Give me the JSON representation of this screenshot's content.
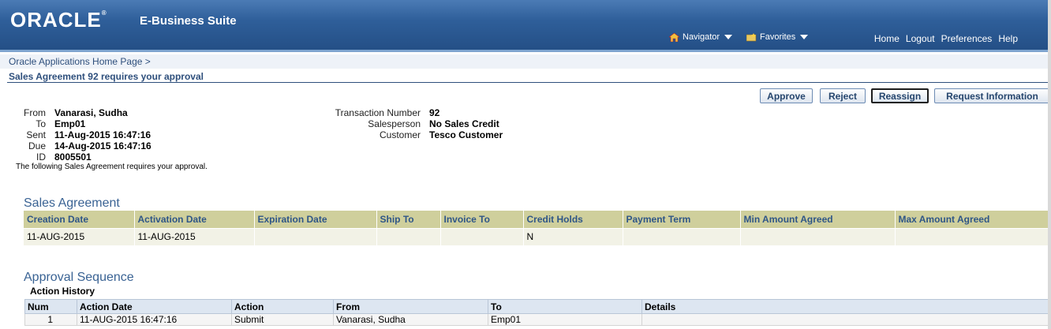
{
  "header": {
    "brand": "ORACLE",
    "suite": "E-Business Suite",
    "navigator": "Navigator",
    "favorites": "Favorites",
    "links": [
      "Home",
      "Logout",
      "Preferences",
      "Help"
    ]
  },
  "breadcrumb": {
    "home": "Oracle Applications Home Page",
    "sep": ">"
  },
  "page_title": "Sales Agreement 92 requires your approval",
  "buttons": {
    "approve": "Approve",
    "reject": "Reject",
    "reassign": "Reassign",
    "request_info": "Request Information"
  },
  "notification": {
    "from_label": "From",
    "from": "Vanarasi, Sudha",
    "to_label": "To",
    "to": "Emp01",
    "sent_label": "Sent",
    "sent": "11-Aug-2015 16:47:16",
    "due_label": "Due",
    "due": "14-Aug-2015 16:47:16",
    "id_label": "ID",
    "id": "8005501",
    "txn_label": "Transaction Number",
    "txn": "92",
    "salesperson_label": "Salesperson",
    "salesperson": "No Sales Credit",
    "customer_label": "Customer",
    "customer": "Tesco Customer",
    "note": "The following Sales Agreement requires your approval."
  },
  "sales_agreement": {
    "title": "Sales Agreement",
    "columns": [
      "Creation Date",
      "Activation Date",
      "Expiration Date",
      "Ship To",
      "Invoice To",
      "Credit Holds",
      "Payment Term",
      "Min Amount Agreed",
      "Max Amount Agreed"
    ],
    "row": [
      "11-AUG-2015",
      "11-AUG-2015",
      "",
      "",
      "",
      "N",
      "",
      "",
      ""
    ]
  },
  "approval": {
    "title": "Approval Sequence",
    "history_title": "Action History",
    "columns": [
      "Num",
      "Action Date",
      "Action",
      "From",
      "To",
      "Details"
    ],
    "row": [
      "1",
      "11-AUG-2015 16:47:16",
      "Submit",
      "Vanarasi, Sudha",
      "Emp01",
      ""
    ]
  }
}
